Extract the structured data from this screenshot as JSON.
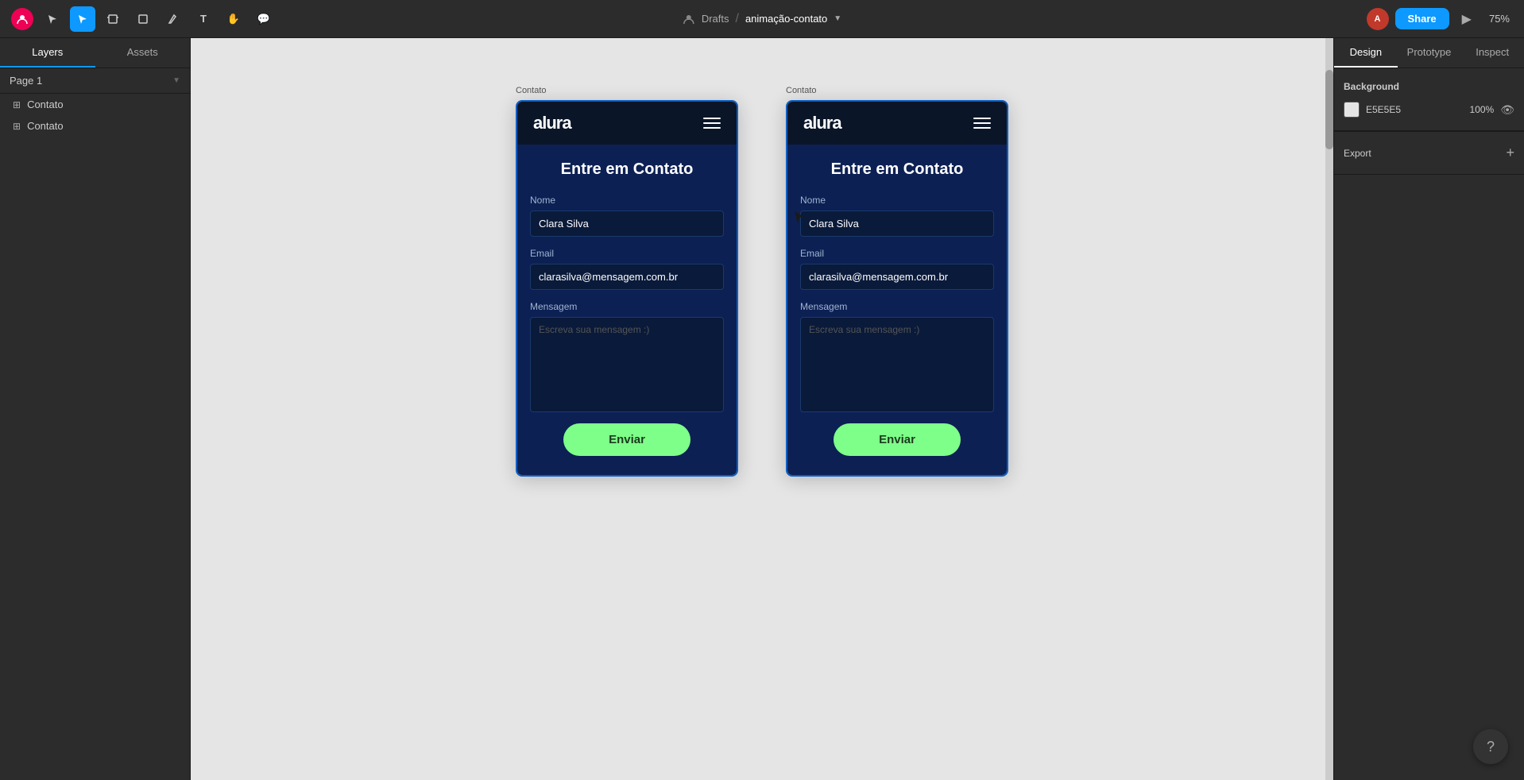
{
  "toolbar": {
    "workspace_label": "Drafts",
    "separator": "/",
    "project_name": "animação-contato",
    "share_label": "Share",
    "zoom_level": "75%",
    "tools": [
      {
        "name": "selector",
        "icon": "▲",
        "active": false
      },
      {
        "name": "move",
        "icon": "↖",
        "active": true
      },
      {
        "name": "frame",
        "icon": "⊞",
        "active": false
      },
      {
        "name": "shape",
        "icon": "□",
        "active": false
      },
      {
        "name": "pen",
        "icon": "/",
        "active": false
      },
      {
        "name": "text",
        "icon": "T",
        "active": false
      },
      {
        "name": "hand",
        "icon": "✋",
        "active": false
      },
      {
        "name": "comment",
        "icon": "💬",
        "active": false
      }
    ]
  },
  "left_sidebar": {
    "tab_layers": "Layers",
    "tab_assets": "Assets",
    "page_label": "Page 1",
    "layers": [
      {
        "label": "Contato"
      },
      {
        "label": "Contato"
      }
    ]
  },
  "canvas": {
    "background_color": "#e5e5e5",
    "frames": [
      {
        "label": "Contato",
        "nav": {
          "logo": "alura",
          "menu_icon": "≡"
        },
        "body": {
          "title": "Entre em Contato",
          "fields": [
            {
              "label": "Nome",
              "value": "Clara Silva",
              "type": "input"
            },
            {
              "label": "Email",
              "value": "clarasilva@mensagem.com.br",
              "type": "input"
            },
            {
              "label": "Mensagem",
              "placeholder": "Escreva sua mensagem :)",
              "type": "textarea"
            }
          ],
          "submit": "Enviar"
        }
      },
      {
        "label": "Contato",
        "nav": {
          "logo": "alura",
          "menu_icon": "≡"
        },
        "body": {
          "title": "Entre em Contato",
          "fields": [
            {
              "label": "Nome",
              "value": "Clara Silva",
              "type": "input"
            },
            {
              "label": "Email",
              "value": "clarasilva@mensagem.com.br",
              "type": "input"
            },
            {
              "label": "Mensagem",
              "placeholder": "Escreva sua mensagem :)",
              "type": "textarea"
            }
          ],
          "submit": "Enviar"
        }
      }
    ]
  },
  "right_panel": {
    "tab_design": "Design",
    "tab_prototype": "Prototype",
    "tab_inspect": "Inspect",
    "background_section": {
      "title": "Background",
      "color_hex": "E5E5E5",
      "opacity": "100%"
    },
    "export_section": {
      "title": "Export",
      "add_label": "+"
    }
  },
  "help_button": "?"
}
